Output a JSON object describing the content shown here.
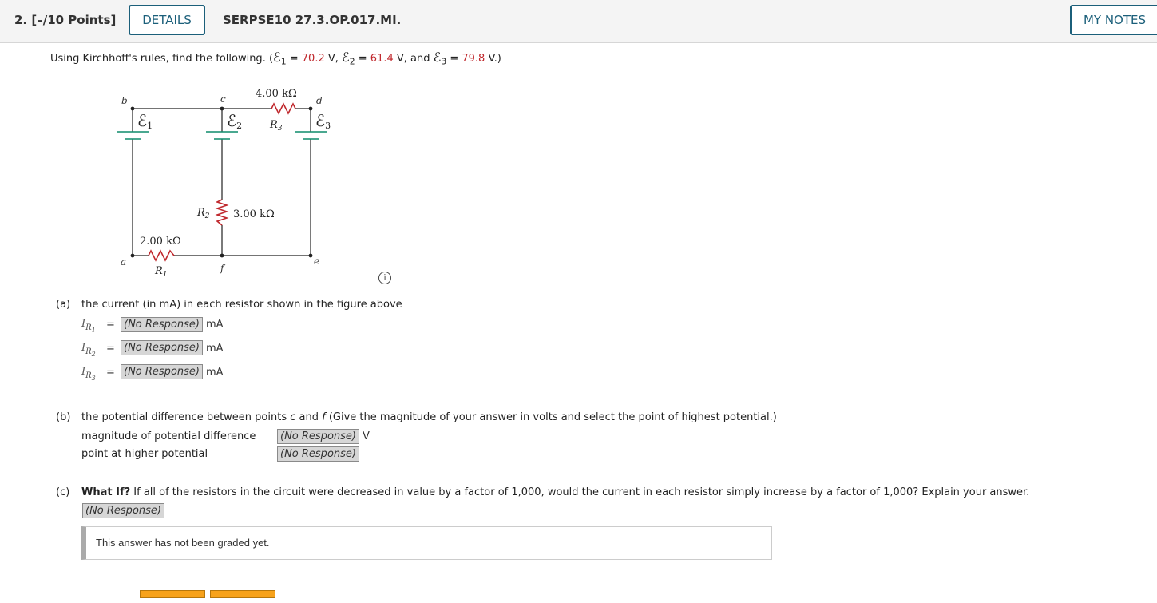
{
  "header": {
    "question_number": "2.",
    "points": "[–/10 Points]",
    "details_label": "DETAILS",
    "question_code": "SERPSE10 27.3.OP.017.MI.",
    "my_notes_label": "MY NOTES"
  },
  "prompt": {
    "intro": "Using Kirchhoff's rules, find the following. (",
    "emf_symbol": "ℰ",
    "e1_sub": "1",
    "e1_value": "70.2",
    "e2_sub": "2",
    "e2_value": "61.4",
    "e3_sub": "3",
    "e3_value": "79.8",
    "unit_v": "V",
    "sep1": " V, ",
    "sep2": " V, and ",
    "end": " V.)",
    "equals": " = "
  },
  "circuit": {
    "node_labels": [
      "a",
      "b",
      "c",
      "d",
      "e",
      "f"
    ],
    "r1_value": "2.00 kΩ",
    "r1_label": "R",
    "r1_sub": "1",
    "r2_value": "3.00 kΩ",
    "r2_label": "R",
    "r2_sub": "2",
    "r3_value": "4.00 kΩ",
    "r3_label": "R",
    "r3_sub": "3",
    "emf_label": "ℰ",
    "emf_subs": [
      "1",
      "2",
      "3"
    ]
  },
  "info_icon": "i",
  "part_a": {
    "label": "(a)",
    "text": "the current (in mA) in each resistor shown in the figure above",
    "rows": [
      {
        "var": "I",
        "sub": "R",
        "subsub": "1",
        "eq": "=",
        "value": "(No Response)",
        "unit": "mA"
      },
      {
        "var": "I",
        "sub": "R",
        "subsub": "2",
        "eq": "=",
        "value": "(No Response)",
        "unit": "mA"
      },
      {
        "var": "I",
        "sub": "R",
        "subsub": "3",
        "eq": "=",
        "value": "(No Response)",
        "unit": "mA"
      }
    ]
  },
  "part_b": {
    "label": "(b)",
    "text_pre": "the potential difference between points ",
    "point_c": "c",
    "text_and": " and ",
    "point_f": "f",
    "text_post": " (Give the magnitude of your answer in volts and select the point of highest potential.)",
    "row1_label": "magnitude of potential difference",
    "row1_value": "(No Response)",
    "row1_unit": "V",
    "row2_label": "point at higher potential",
    "row2_value": "(No Response)"
  },
  "part_c": {
    "label": "(c)",
    "bold_lead": "What If?",
    "text": " If all of the resistors in the circuit were decreased in value by a factor of 1,000, would the current in each resistor simply increase by a factor of 1,000? Explain your answer.",
    "value": "(No Response)",
    "graded_note": "This answer has not been graded yet."
  },
  "colors": {
    "accent": "#1b5f7a",
    "red_values": "#c0282d",
    "resistor": "#c0282d",
    "battery_plate": "#0f8c6c",
    "no_response_bg": "#d6d6d6"
  }
}
